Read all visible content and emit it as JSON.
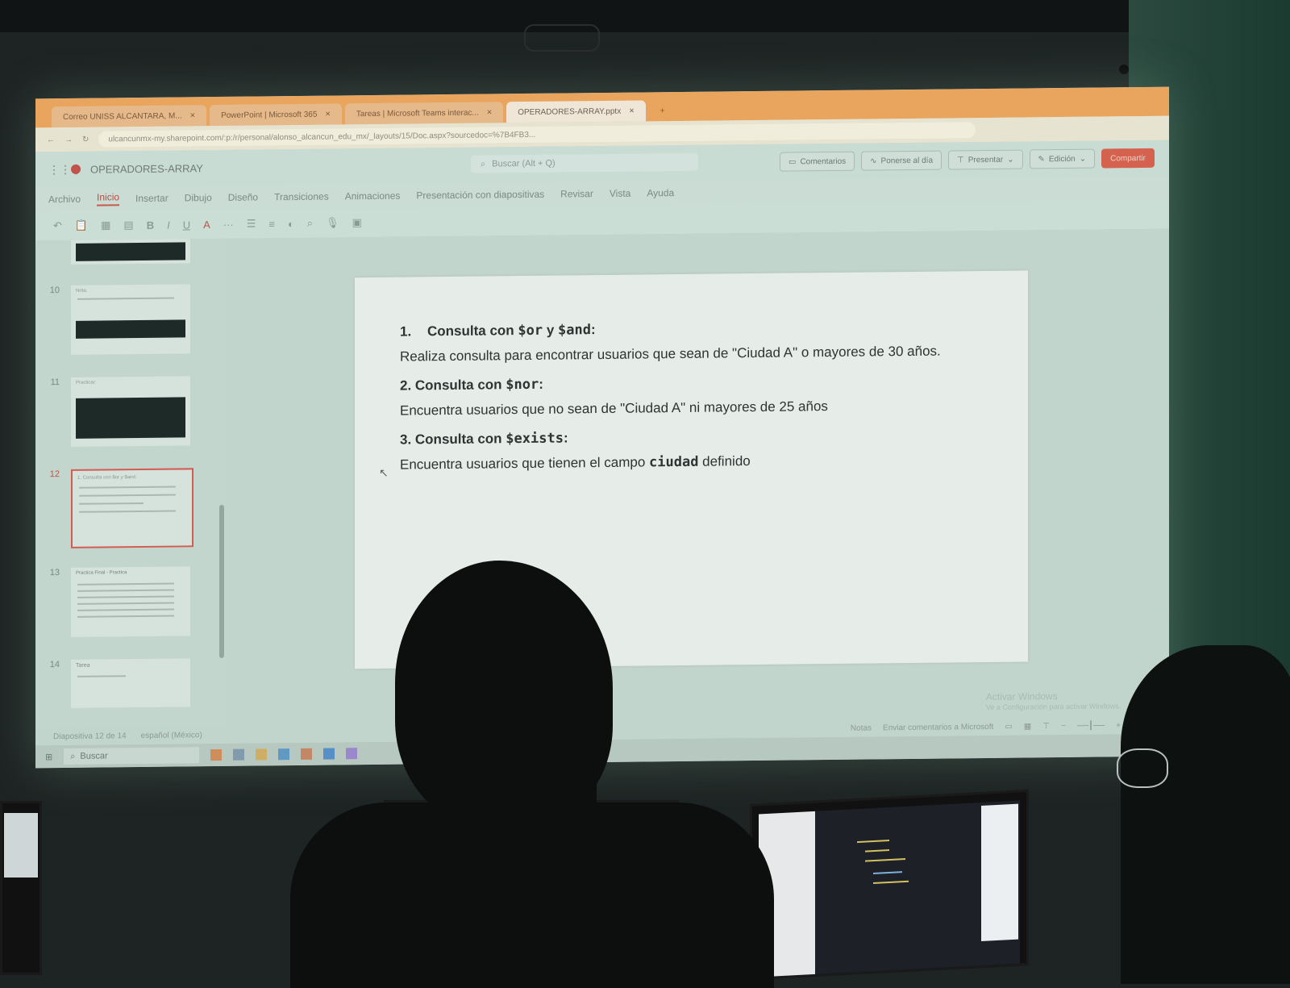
{
  "browser": {
    "tabs": [
      {
        "label": "Correo UNISS ALCANTARA, M..."
      },
      {
        "label": "PowerPoint | Microsoft 365"
      },
      {
        "label": "Tareas | Microsoft Teams interac..."
      },
      {
        "label": "OPERADORES-ARRAY.pptx",
        "active": true
      }
    ],
    "new_tab": "+",
    "url": "ulcancunmx-my.sharepoint.com/:p:/r/personal/alonso_alcancun_edu_mx/_layouts/15/Doc.aspx?sourcedoc=%7B4FB3..."
  },
  "app": {
    "doc_title": "OPERADORES-ARRAY",
    "search_placeholder": "Buscar (Alt + Q)",
    "buttons": {
      "comments": "Comentarios",
      "catch_up": "Ponerse al día",
      "present": "Presentar",
      "editing": "Edición",
      "share": "Compartir"
    },
    "menu": [
      "Archivo",
      "Inicio",
      "Insertar",
      "Dibujo",
      "Diseño",
      "Transiciones",
      "Animaciones",
      "Presentación con diapositivas",
      "Revisar",
      "Vista",
      "Ayuda"
    ],
    "active_menu": "Inicio"
  },
  "thumbnails": [
    {
      "num": "10",
      "title": "Nota:"
    },
    {
      "num": "11",
      "title": "Practicar:"
    },
    {
      "num": "12",
      "title": "1. Consulta con $or y $and:"
    },
    {
      "num": "13",
      "title": "Practica Final - Practica"
    },
    {
      "num": "14",
      "title": "Tarea"
    }
  ],
  "slide": {
    "h1_num": "1.",
    "h1_text": "Consulta con ",
    "h1_code1": "$or",
    "h1_mid": " y ",
    "h1_code2": "$and",
    "h1_end": ":",
    "p1": "Realiza consulta para encontrar usuarios que sean de \"Ciudad A\" o mayores de 30 años.",
    "h2_text": "2. Consulta con ",
    "h2_code": "$nor",
    "h2_end": ":",
    "p2": "Encuentra usuarios que no sean de \"Ciudad A\" ni mayores de 25 años",
    "h3_text": "3. Consulta con ",
    "h3_code": "$exists",
    "h3_end": ":",
    "p3_a": "Encuentra usuarios que tienen el campo ",
    "p3_code": "ciudad",
    "p3_b": " definido"
  },
  "watermark": {
    "line1": "Activar Windows",
    "line2": "Ve a Configuración para activar Windows."
  },
  "status": {
    "slide_count": "Diapositiva 12 de 14",
    "language": "español (México)",
    "notes": "Notas",
    "feedback": "Enviar comentarios a Microsoft"
  },
  "taskbar": {
    "search": "Buscar"
  }
}
